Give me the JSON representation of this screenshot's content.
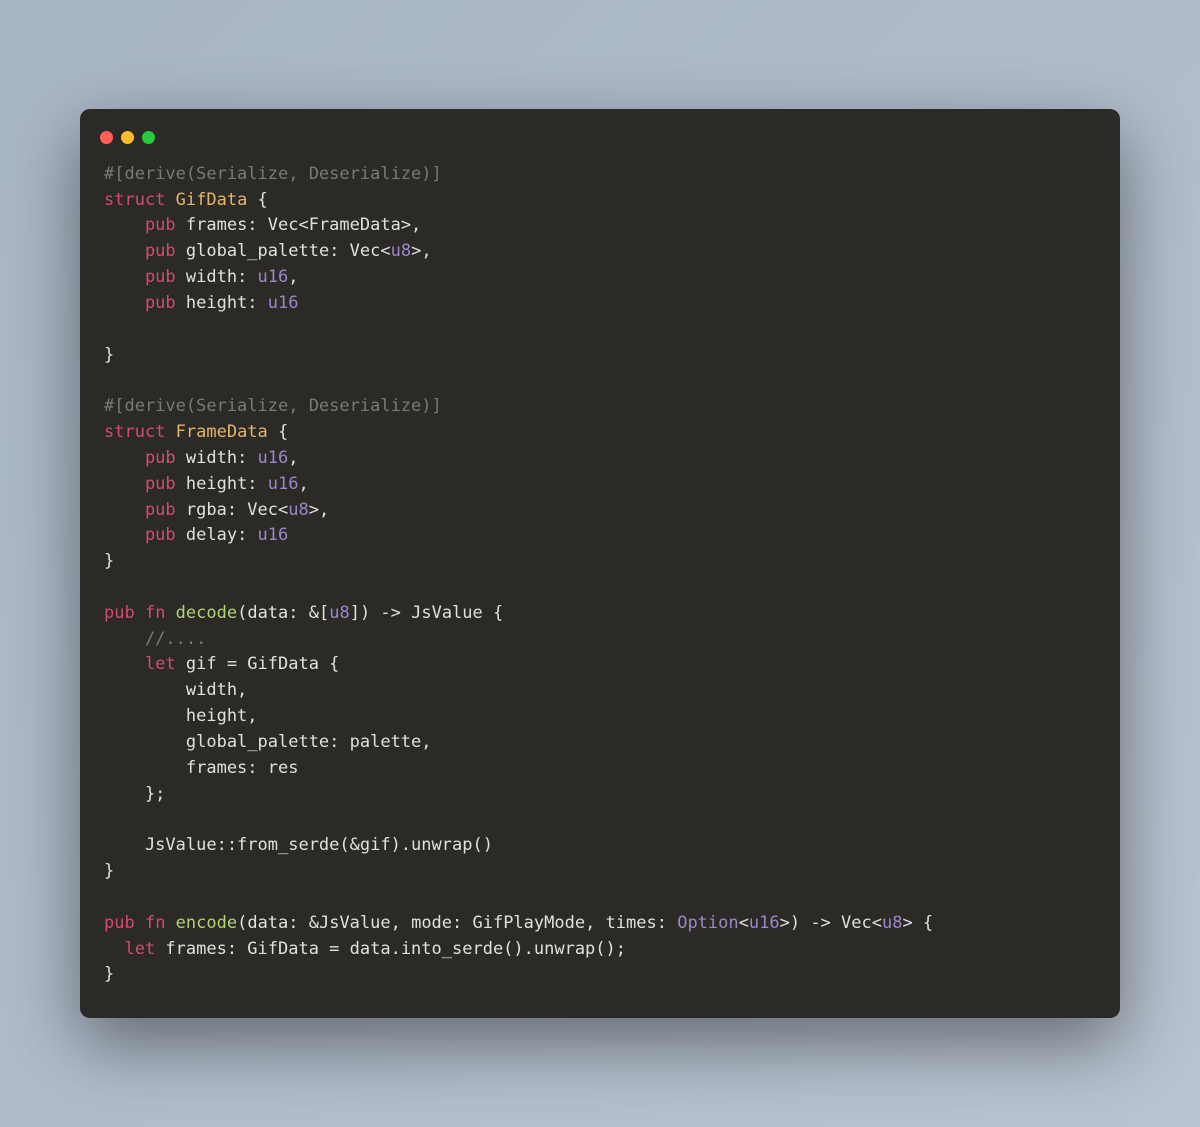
{
  "titlebar": {
    "button_red": "close",
    "button_yellow": "minimize",
    "button_green": "zoom"
  },
  "code": {
    "l1_comment": "#[derive(Serialize, Deserialize)]",
    "l2_kw": "struct",
    "l2_name": " GifData",
    "l2_brace": " {",
    "l3_pub": "    pub",
    "l3_field": " frames: Vec<FrameData>,",
    "l4_pub": "    pub",
    "l4_field": " global_palette: Vec<",
    "l4_type": "u8",
    "l4_end": ">,",
    "l5_pub": "    pub",
    "l5_field": " width: ",
    "l5_type": "u16",
    "l5_end": ",",
    "l6_pub": "    pub",
    "l6_field": " height: ",
    "l6_type": "u16",
    "l7_blank": " ",
    "l8_close": "}",
    "l9_blank": " ",
    "l10_comment": "#[derive(Serialize, Deserialize)]",
    "l11_kw": "struct",
    "l11_name": " FrameData",
    "l11_brace": " {",
    "l12_pub": "    pub",
    "l12_field": " width: ",
    "l12_type": "u16",
    "l12_end": ",",
    "l13_pub": "    pub",
    "l13_field": " height: ",
    "l13_type": "u16",
    "l13_end": ",",
    "l14_pub": "    pub",
    "l14_field": " rgba: Vec<",
    "l14_type": "u8",
    "l14_end": ">,",
    "l15_pub": "    pub",
    "l15_field": " delay: ",
    "l15_type": "u16",
    "l16_close": "}",
    "l17_blank": " ",
    "l18_pub": "pub",
    "l18_fn": " fn",
    "l18_name": " decode",
    "l18_sig1": "(data: &[",
    "l18_type": "u8",
    "l18_sig2": "]) -> JsValue {",
    "l19_comment": "    //....",
    "l20_let": "    let",
    "l20_rest": " gif = GifData {",
    "l21": "        width,",
    "l22": "        height,",
    "l23": "        global_palette: palette,",
    "l24": "        frames: res",
    "l25": "    };",
    "l26_blank": " ",
    "l27": "    JsValue::from_serde(&gif).unwrap()",
    "l28_close": "}",
    "l29_blank": " ",
    "l30_pub": "pub",
    "l30_fn": " fn",
    "l30_name": " encode",
    "l30_sig1": "(data: &JsValue, mode: GifPlayMode, times: ",
    "l30_opt": "Option",
    "l30_lt": "<",
    "l30_type": "u16",
    "l30_gt": ">",
    "l30_sig2": ") -> Vec<",
    "l30_type2": "u8",
    "l30_sig3": "> {",
    "l31_let": "  let",
    "l31_rest": " frames: GifData = data.into_serde().unwrap();",
    "l32_close": "}"
  }
}
